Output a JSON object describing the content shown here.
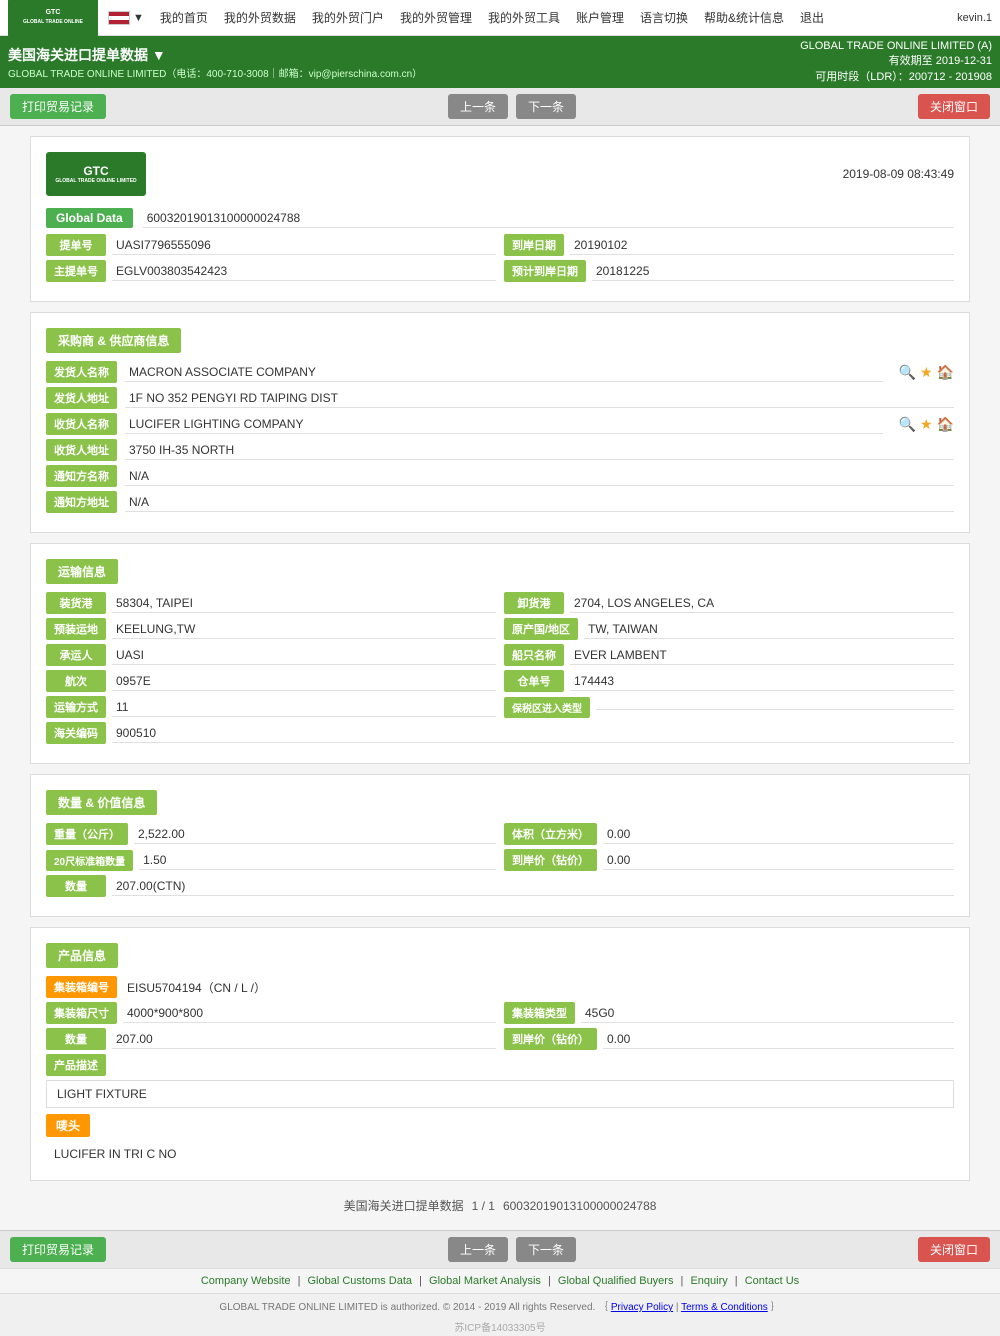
{
  "topNav": {
    "logoText": "GLOBAL TRADE ONLINE LIMITED",
    "flagAlt": "US Flag",
    "navItems": [
      "我的首页",
      "我的外贸数据",
      "我的外贸门户",
      "我的外贸管理",
      "我的外贸工具",
      "账户管理",
      "语言切换",
      "帮助&统计信息",
      "退出"
    ],
    "userLabel": "kevin.1"
  },
  "secondNav": {
    "title": "美国海关进口提单数据 ▼",
    "subtitle": "GLOBAL TRADE ONLINE LIMITED（电话：400-710-3008｜邮箱：vip@pierschina.com.cn）",
    "rightLine1": "GLOBAL TRADE ONLINE LIMITED (A)",
    "rightLine2": "有效期至 2019-12-31",
    "rightLine3": "可用时段（LDR）：200712 - 201908"
  },
  "toolbar": {
    "printBtn": "打印贸易记录",
    "prevBtn": "上一条",
    "nextBtn": "下一条",
    "closeBtn": "关闭窗口"
  },
  "document": {
    "datetime": "2019-08-09 08:43:49",
    "globalDataLabel": "Global Data",
    "globalDataValue": "60032019013100000024788",
    "billLabel": "提单号",
    "billValue": "UASI7796555096",
    "arrivalDateLabel": "到岸日期",
    "arrivalDateValue": "20190102",
    "masterBillLabel": "主提单号",
    "masterBillValue": "EGLV003803542423",
    "estimatedArrivalLabel": "预计到岸日期",
    "estimatedArrivalValue": "20181225"
  },
  "buyerSupplier": {
    "sectionTitle": "采购商 & 供应商信息",
    "shipperLabel": "发货人名称",
    "shipperValue": "MACRON ASSOCIATE COMPANY",
    "shipperAddrLabel": "发货人地址",
    "shipperAddrValue": "1F NO 352 PENGYI RD TAIPING DIST",
    "consigneeLabel": "收货人名称",
    "consigneeValue": "LUCIFER LIGHTING COMPANY",
    "consigneeAddrLabel": "收货人地址",
    "consigneeAddrValue": "3750 IH-35 NORTH",
    "notifyLabel": "通知方名称",
    "notifyValue": "N/A",
    "notifyAddrLabel": "通知方地址",
    "notifyAddrValue": "N/A"
  },
  "transport": {
    "sectionTitle": "运输信息",
    "loadPortLabel": "装货港",
    "loadPortValue": "58304, TAIPEI",
    "dischargePortLabel": "卸货港",
    "dischargePortValue": "2704, LOS ANGELES, CA",
    "loadPlaceLabel": "预装运地",
    "loadPlaceValue": "KEELUNG,TW",
    "originCountryLabel": "原产国/地区",
    "originCountryValue": "TW, TAIWAN",
    "carrierLabel": "承运人",
    "carrierValue": "UASI",
    "vesselLabel": "船只名称",
    "vesselValue": "EVER LAMBENT",
    "voyageLabel": "航次",
    "voyageValue": "0957E",
    "warehouseLabel": "仓单号",
    "warehouseValue": "174443",
    "transportModeLabel": "运输方式",
    "transportModeValue": "11",
    "bonedTypeLabel": "保税区进入类型",
    "bonedTypeValue": "",
    "customsLabel": "海关编码",
    "customsValue": "900510"
  },
  "quantity": {
    "sectionTitle": "数量 & 价值信息",
    "weightLabel": "重量（公斤）",
    "weightValue": "2,522.00",
    "volumeLabel": "体积（立方米）",
    "volumeValue": "0.00",
    "container20Label": "20尺标准箱数量",
    "container20Value": "1.50",
    "arrivalPriceLabel": "到岸价（钻价）",
    "arrivalPriceValue": "0.00",
    "quantityLabel": "数量",
    "quantityValue": "207.00(CTN)"
  },
  "product": {
    "sectionTitle": "产品信息",
    "containerNoLabel": "集装箱编号",
    "containerNoValue": "EISU5704194（CN / L /）",
    "containerSizeLabel": "集装箱尺寸",
    "containerSizeValue": "4000*900*800",
    "containerTypeLabel": "集装箱类型",
    "containerTypeValue": "45G0",
    "quantityLabel": "数量",
    "quantityValue": "207.00",
    "arrivalPriceLabel": "到岸价（钻价）",
    "arrivalPriceValue": "0.00",
    "descriptionLabel": "产品描述",
    "descriptionValue": "LIGHT FIXTURE",
    "marksLabel": "唛头",
    "marksValue": "LUCIFER IN TRI C NO"
  },
  "pagination": {
    "text": "美国海关进口提单数据",
    "current": "1 / 1",
    "billNo": "60032019013100000024788"
  },
  "footerLinks": {
    "links": [
      "Company Website",
      "Global Customs Data",
      "Global Market Analysis",
      "Global Qualified Buyers",
      "Enquiry",
      "Contact Us"
    ],
    "copyright": "GLOBAL TRADE ONLINE LIMITED is authorized. © 2014 - 2019 All rights Reserved. ｛",
    "privacyLabel": "Privacy Policy",
    "termsLabel": "Terms & Conditions",
    "closeBrace": "｝",
    "icp": "苏ICP备14033305号"
  }
}
